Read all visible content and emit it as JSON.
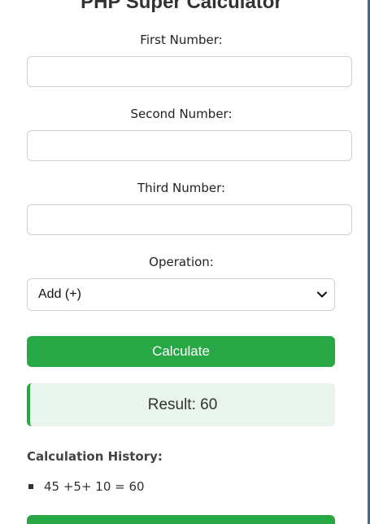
{
  "app": {
    "title": "PHP Super Calculator"
  },
  "form": {
    "first_label": "First Number:",
    "first_value": "",
    "second_label": "Second Number:",
    "second_value": "",
    "third_label": "Third Number:",
    "third_value": "",
    "operation_label": "Operation:",
    "operation_selected": "Add (+)",
    "calculate_label": "Calculate"
  },
  "result": {
    "text": "Result: 60"
  },
  "history": {
    "title": "Calculation History:",
    "items": [
      "45 +5+ 10 = 60"
    ]
  },
  "colors": {
    "accent": "#28a745",
    "result_bg": "#e8f4ec"
  },
  "icons": {
    "select_arrow": "chevron-down-icon",
    "list_bullet": "square-bullet-icon"
  }
}
